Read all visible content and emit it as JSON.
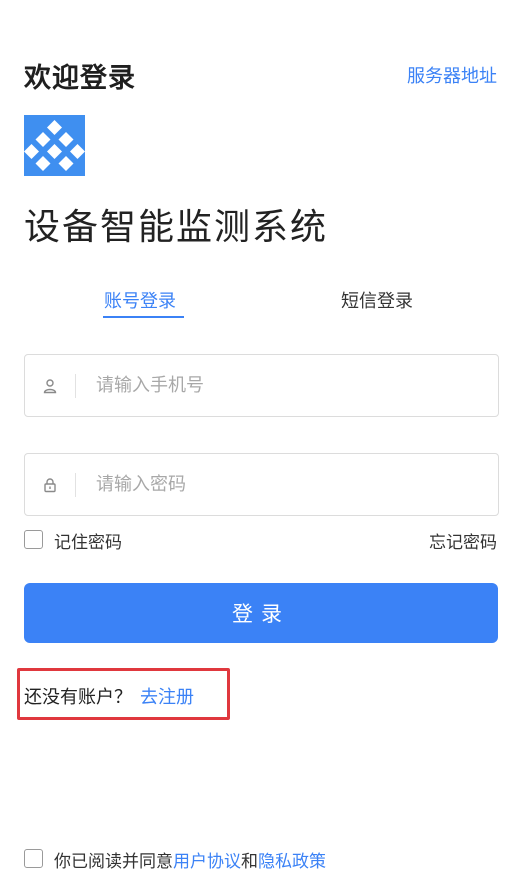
{
  "header": {
    "welcome": "欢迎登录",
    "server_address": "服务器地址"
  },
  "brand": {
    "system_title": "设备智能监测系统",
    "logo_color": "#3f8ff0"
  },
  "tabs": [
    {
      "label": "账号登录",
      "active": true
    },
    {
      "label": "短信登录",
      "active": false
    }
  ],
  "form": {
    "phone": {
      "placeholder": "请输入手机号",
      "icon": "user-icon"
    },
    "password": {
      "placeholder": "请输入密码",
      "icon": "lock-icon"
    },
    "remember_label": "记住密码",
    "remember_checked": false,
    "forgot_label": "忘记密码",
    "login_button": "登录"
  },
  "register": {
    "prompt": "还没有账户？",
    "link": "去注册"
  },
  "agreement": {
    "checked": false,
    "prefix": "你已阅读并同意",
    "user_agreement": "用户协议",
    "conjunction": "和",
    "privacy_policy": "隐私政策"
  },
  "colors": {
    "accent": "#3b82f6",
    "highlight": "#e0383e"
  }
}
